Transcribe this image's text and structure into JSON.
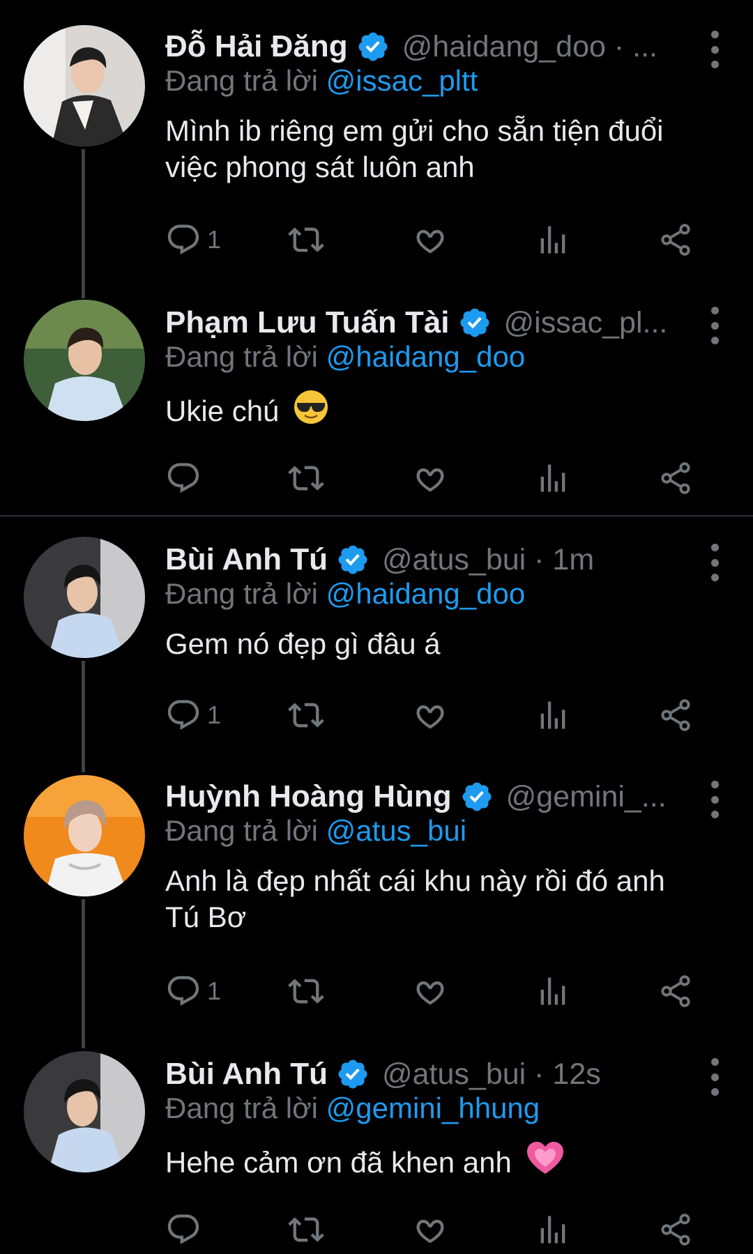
{
  "reply_prefix": "Đang trả lời",
  "tweets": [
    {
      "name": "Đỗ Hải Đăng",
      "handle": "@haidang_doo · ...",
      "reply_to": "@issac_pltt",
      "text": "Mình ib riêng em gửi cho sẵn tiện đuổi việc phong sát luôn anh",
      "reply_count": "1",
      "emoji": ""
    },
    {
      "name": "Phạm Lưu Tuấn Tài",
      "handle": "@issac_pl...",
      "reply_to": "@haidang_doo",
      "text": "Ukie chú",
      "reply_count": "",
      "emoji": "sunglasses-emoji"
    },
    {
      "name": "Bùi Anh Tú",
      "handle": "@atus_bui · 1m",
      "reply_to": "@haidang_doo",
      "text": "Gem nó đẹp gì đâu á",
      "reply_count": "1",
      "emoji": ""
    },
    {
      "name": "Huỳnh Hoàng Hùng",
      "handle": "@gemini_...",
      "reply_to": "@atus_bui",
      "text": "Anh là đẹp nhất cái khu này rồi đó anh Tú Bơ",
      "reply_count": "1",
      "emoji": ""
    },
    {
      "name": "Bùi Anh Tú",
      "handle": "@atus_bui · 12s",
      "reply_to": "@gemini_hhung",
      "text": "Hehe cảm ơn đã khen anh",
      "reply_count": "",
      "emoji": "sparkling-heart-emoji"
    }
  ],
  "colors": {
    "background": "#000000",
    "text": "#e7e9ea",
    "muted": "#71767b",
    "link": "#1d9bf0",
    "verified": "#1d9bf0"
  }
}
